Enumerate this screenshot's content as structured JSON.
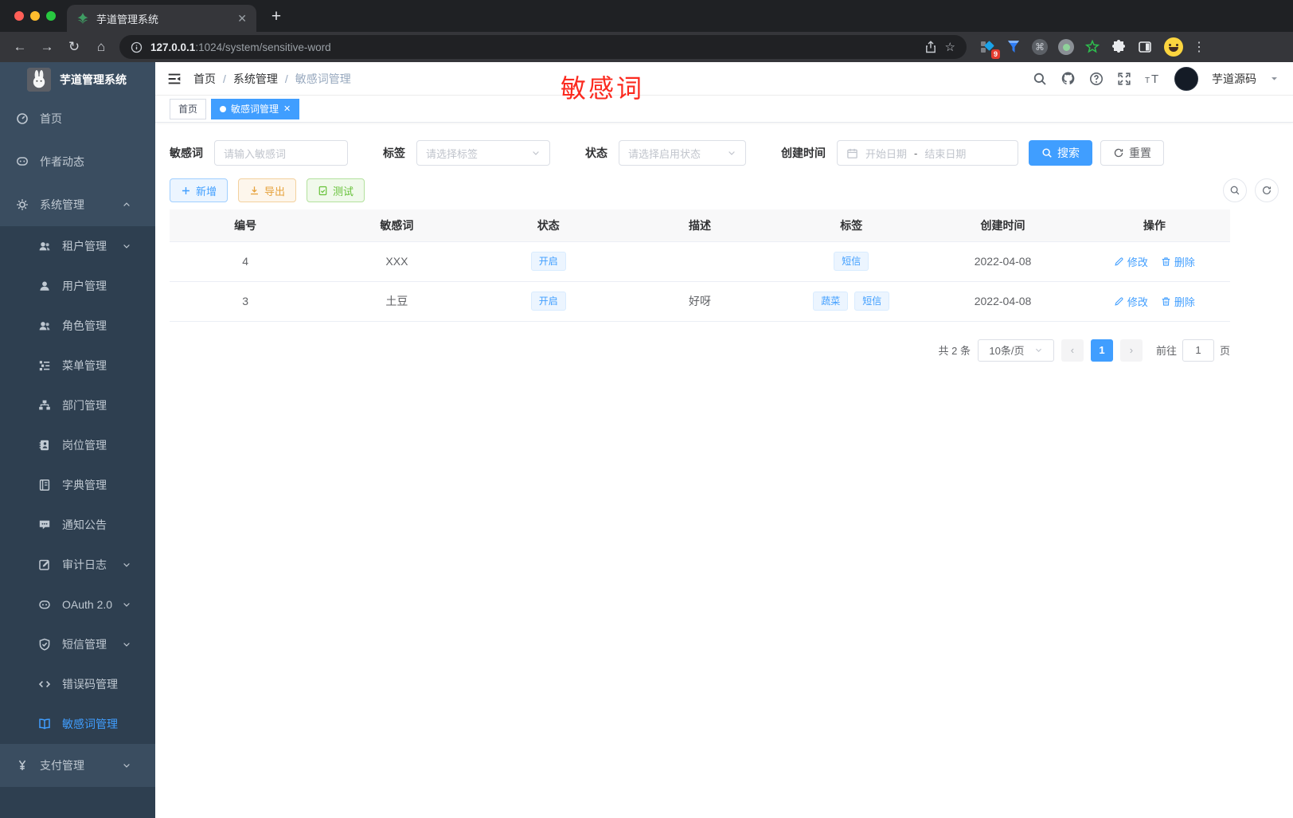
{
  "browser": {
    "tab_title": "芋道管理系统",
    "url_host": "127.0.0.1",
    "url_rest": ":1024/system/sensitive-word",
    "extension_badge": "9"
  },
  "sidebar": {
    "title": "芋道管理系统",
    "items": [
      {
        "icon": "dashboard-icon",
        "label": "首页",
        "level": 1
      },
      {
        "icon": "chat-icon",
        "label": "作者动态",
        "level": 1
      },
      {
        "icon": "gear-icon",
        "label": "系统管理",
        "level": 1,
        "chevron": "up"
      },
      {
        "icon": "users-icon",
        "label": "租户管理",
        "level": 2,
        "chevron": "down"
      },
      {
        "icon": "user-icon",
        "label": "用户管理",
        "level": 2
      },
      {
        "icon": "users-icon",
        "label": "角色管理",
        "level": 2
      },
      {
        "icon": "tree-icon",
        "label": "菜单管理",
        "level": 2
      },
      {
        "icon": "org-icon",
        "label": "部门管理",
        "level": 2
      },
      {
        "icon": "post-icon",
        "label": "岗位管理",
        "level": 2
      },
      {
        "icon": "dict-icon",
        "label": "字典管理",
        "level": 2
      },
      {
        "icon": "notice-icon",
        "label": "通知公告",
        "level": 2
      },
      {
        "icon": "log-icon",
        "label": "审计日志",
        "level": 2,
        "chevron": "down"
      },
      {
        "icon": "robot-icon",
        "label": "OAuth 2.0",
        "level": 2,
        "chevron": "down"
      },
      {
        "icon": "shield-icon",
        "label": "短信管理",
        "level": 2,
        "chevron": "down"
      },
      {
        "icon": "code-icon",
        "label": "错误码管理",
        "level": 2
      },
      {
        "icon": "book-open-icon",
        "label": "敏感词管理",
        "level": 2,
        "active": true
      },
      {
        "icon": "yen-icon",
        "label": "支付管理",
        "level": 1,
        "chevron": "down"
      }
    ]
  },
  "header": {
    "breadcrumb": [
      "首页",
      "系统管理",
      "敏感词管理"
    ],
    "username": "芋道源码"
  },
  "annotation": {
    "text": "敏感词",
    "color": "#fb2a1f"
  },
  "tags_view": {
    "tabs": [
      {
        "label": "首页",
        "active": false
      },
      {
        "label": "敏感词管理",
        "active": true,
        "closable": true
      }
    ]
  },
  "filters": {
    "keyword": {
      "label": "敏感词",
      "placeholder": "请输入敏感词"
    },
    "tag": {
      "label": "标签",
      "placeholder": "请选择标签"
    },
    "status": {
      "label": "状态",
      "placeholder": "请选择启用状态"
    },
    "created": {
      "label": "创建时间",
      "start_placeholder": "开始日期",
      "separator": "-",
      "end_placeholder": "结束日期"
    },
    "search_label": "搜索",
    "reset_label": "重置"
  },
  "actions": {
    "add_label": "新增",
    "export_label": "导出",
    "test_label": "测试"
  },
  "table": {
    "columns": [
      "编号",
      "敏感词",
      "状态",
      "描述",
      "标签",
      "创建时间",
      "操作"
    ],
    "rows": [
      {
        "id": "4",
        "word": "XXX",
        "status": "开启",
        "desc": "",
        "tags": [
          "短信"
        ],
        "created": "2022-04-08"
      },
      {
        "id": "3",
        "word": "土豆",
        "status": "开启",
        "desc": "好呀",
        "tags": [
          "蔬菜",
          "短信"
        ],
        "created": "2022-04-08"
      }
    ],
    "edit_label": "修改",
    "delete_label": "删除"
  },
  "pagination": {
    "total": "共 2 条",
    "page_size": "10条/页",
    "prev": "‹",
    "current": "1",
    "next": "›",
    "goto_label": "前往",
    "goto_value": "1",
    "page_unit": "页"
  },
  "colors": {
    "primary": "#409eff",
    "sidebar_bg": "#3a4d60",
    "submenu_bg": "#2e3f50"
  }
}
